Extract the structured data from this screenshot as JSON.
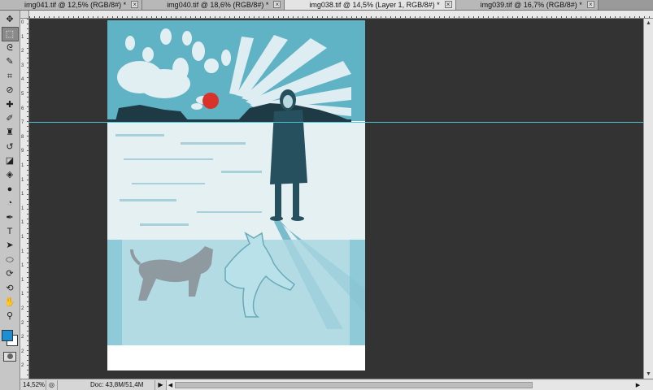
{
  "tabs": [
    {
      "label": "img041.tif @ 12,5% (RGB/8#) *",
      "close": "×",
      "active": false
    },
    {
      "label": "img040.tif @ 18,6% (RGB/8#) *",
      "close": "×",
      "active": false
    },
    {
      "label": "img038.tif @ 14,5% (Layer 1, RGB/8#) *",
      "close": "×",
      "active": true
    },
    {
      "label": "img039.tif @ 16,7% (RGB/8#) *",
      "close": "×",
      "active": false
    }
  ],
  "toolbox": {
    "tools": [
      {
        "name": "move-tool",
        "glyph": "✥"
      },
      {
        "name": "rectangular-marquee-tool",
        "glyph": "⬚",
        "selected": true
      },
      {
        "name": "lasso-tool",
        "glyph": "ᘓ"
      },
      {
        "name": "quick-selection-tool",
        "glyph": "✎"
      },
      {
        "name": "crop-tool",
        "glyph": "⌗"
      },
      {
        "name": "eyedropper-tool",
        "glyph": "⊘"
      },
      {
        "name": "spot-healing-tool",
        "glyph": "✚"
      },
      {
        "name": "brush-tool",
        "glyph": "✐"
      },
      {
        "name": "clone-stamp-tool",
        "glyph": "♜"
      },
      {
        "name": "history-brush-tool",
        "glyph": "↺"
      },
      {
        "name": "eraser-tool",
        "glyph": "◪"
      },
      {
        "name": "paint-bucket-tool",
        "glyph": "◈"
      },
      {
        "name": "blur-tool",
        "glyph": "●"
      },
      {
        "name": "dodge-tool",
        "glyph": "◔"
      },
      {
        "name": "pen-tool",
        "glyph": "✒"
      },
      {
        "name": "type-tool",
        "glyph": "T"
      },
      {
        "name": "path-selection-tool",
        "glyph": "➤"
      },
      {
        "name": "shape-tool",
        "glyph": "⬭"
      },
      {
        "name": "3d-rotate-tool",
        "glyph": "⟳"
      },
      {
        "name": "3d-orbit-tool",
        "glyph": "⟲"
      },
      {
        "name": "hand-tool",
        "glyph": "✋"
      },
      {
        "name": "zoom-tool",
        "glyph": "⚲"
      }
    ],
    "foreground_color": "#1a8fd6",
    "background_color": "#ffffff"
  },
  "ruler_v_numbers": [
    "0",
    "1",
    "2",
    "3",
    "4",
    "5",
    "6",
    "7",
    "8",
    "9",
    "1",
    "1",
    "1",
    "1",
    "1",
    "1",
    "1",
    "1",
    "1",
    "1",
    "2",
    "2",
    "2",
    "2",
    "2"
  ],
  "statusbar": {
    "zoom": "14,52%",
    "doc_info": "Doc: 43,8M/51,4M",
    "arrow": "▶"
  },
  "colors": {
    "sky": "#5fb3c4",
    "sky_dark": "#3f95a8",
    "snow": "#e9f2f5",
    "treeline": "#1e3a44",
    "sun": "#d8322b",
    "figure": "#27505e",
    "dog_gray": "#8f9aa0",
    "dog_light": "#b8e1ea",
    "guide": "#4cc4d8"
  }
}
